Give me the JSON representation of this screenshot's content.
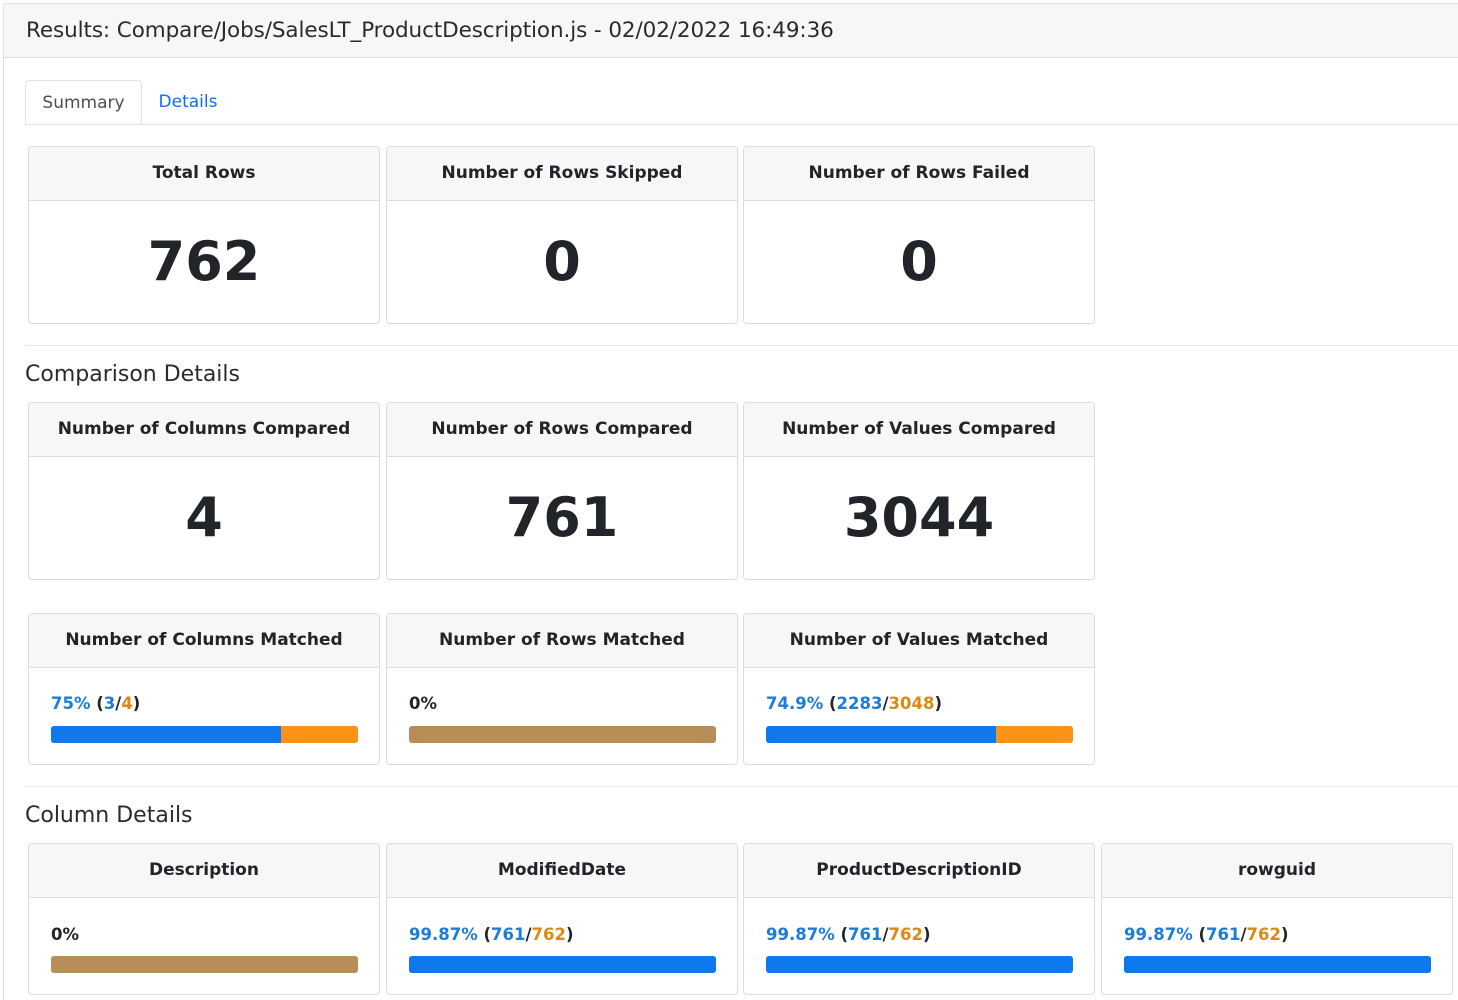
{
  "header": {
    "title": "Results: Compare/Jobs/SalesLT_ProductDescription.js - 02/02/2022 16:49:36"
  },
  "tabs": [
    {
      "label": "Summary",
      "active": true
    },
    {
      "label": "Details",
      "active": false
    }
  ],
  "summary_cards": [
    {
      "label": "Total Rows",
      "value": "762"
    },
    {
      "label": "Number of Rows Skipped",
      "value": "0"
    },
    {
      "label": "Number of Rows Failed",
      "value": "0"
    }
  ],
  "comparison": {
    "title": "Comparison Details",
    "compared_cards": [
      {
        "label": "Number of Columns Compared",
        "value": "4"
      },
      {
        "label": "Number of Rows Compared",
        "value": "761"
      },
      {
        "label": "Number of Values Compared",
        "value": "3044"
      }
    ],
    "matched_cards": [
      {
        "label": "Number of Columns Matched",
        "percent": "75%",
        "matched": "3",
        "total": "4",
        "fraction": 0.75
      },
      {
        "label": "Number of Rows Matched",
        "percent": "0%",
        "matched": null,
        "total": null,
        "fraction": 0
      },
      {
        "label": "Number of Values Matched",
        "percent": "74.9%",
        "matched": "2283",
        "total": "3048",
        "fraction": 0.749
      }
    ]
  },
  "column_details": {
    "title": "Column Details",
    "columns": [
      {
        "label": "Description",
        "percent": "0%",
        "matched": null,
        "total": null,
        "fraction": 0
      },
      {
        "label": "ModifiedDate",
        "percent": "99.87%",
        "matched": "761",
        "total": "762",
        "fraction": 0.9987
      },
      {
        "label": "ProductDescriptionID",
        "percent": "99.87%",
        "matched": "761",
        "total": "762",
        "fraction": 0.9987
      },
      {
        "label": "rowguid",
        "percent": "99.87%",
        "matched": "761",
        "total": "762",
        "fraction": 0.9987
      }
    ]
  },
  "colors": {
    "matched": "#0f78ef",
    "unmatched": "#fd9316",
    "zero": "#b88d57",
    "link": "#0d6efd"
  }
}
